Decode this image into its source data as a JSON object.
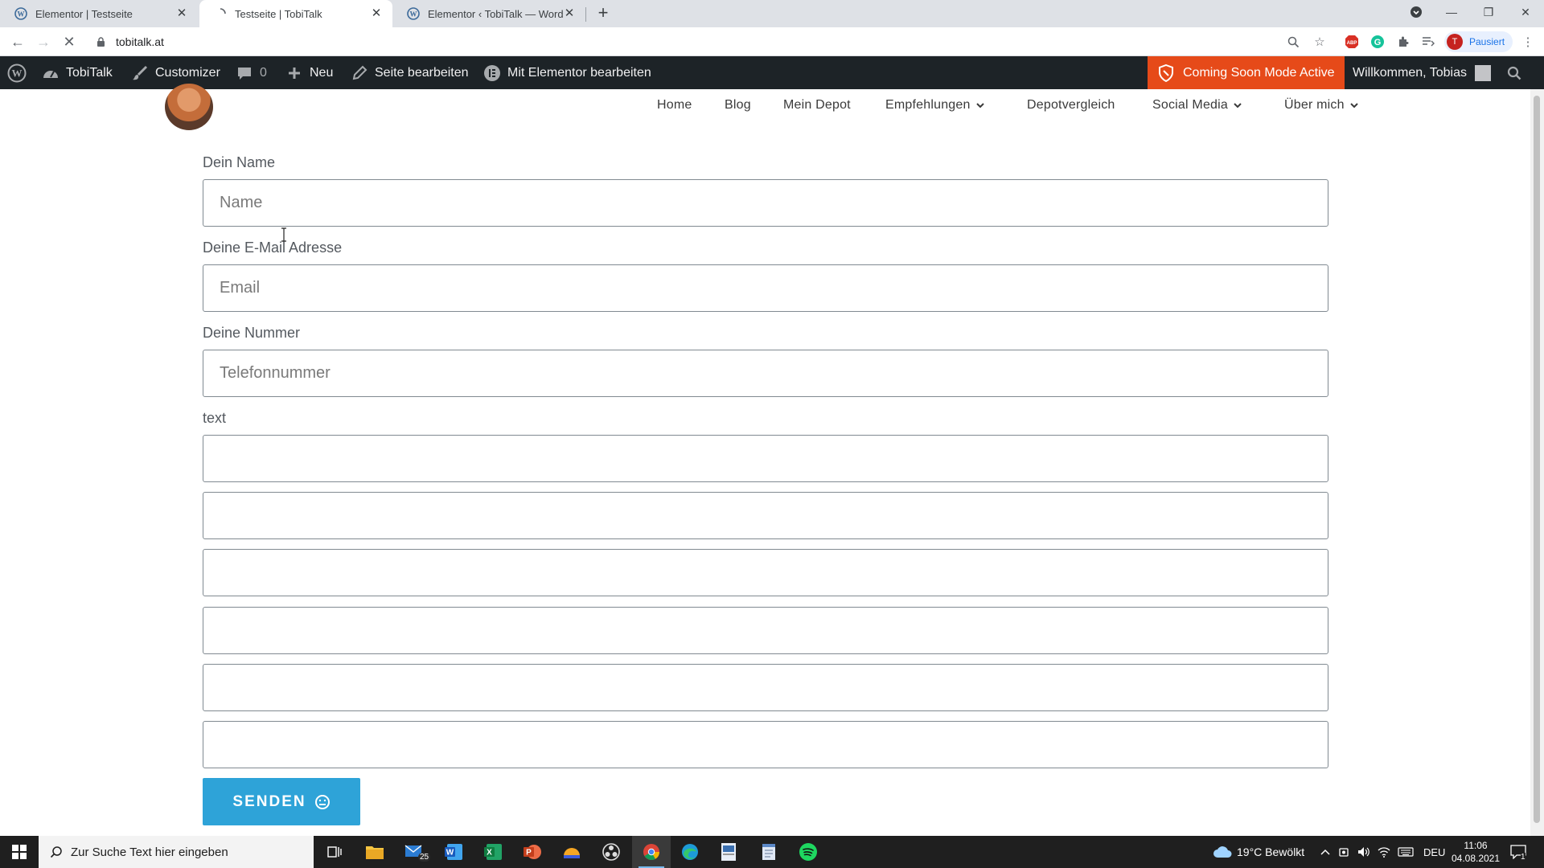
{
  "browser": {
    "tabs": [
      {
        "label": "Elementor | Testseite",
        "icon": "wordpress-icon"
      },
      {
        "label": "Testseite | TobiTalk",
        "icon": "loading-icon"
      },
      {
        "label": "Elementor ‹ TobiTalk — WordPre",
        "icon": "wordpress-icon"
      }
    ],
    "url": "tobitalk.at",
    "profile_initial": "T",
    "profile_status": "Pausiert"
  },
  "adminbar": {
    "site": "TobiTalk",
    "customizer": "Customizer",
    "comments_count": "0",
    "new": "Neu",
    "edit_page": "Seite bearbeiten",
    "edit_elementor": "Mit Elementor bearbeiten",
    "coming_soon": "Coming Soon Mode Active",
    "welcome": "Willkommen, Tobias"
  },
  "nav": {
    "items": [
      "Home",
      "Blog",
      "Mein Depot",
      "Empfehlungen",
      "Depotvergleich",
      "Social Media",
      "Über mich"
    ]
  },
  "form": {
    "name_label": "Dein Name",
    "name_placeholder": "Name",
    "email_label": "Deine E-Mail Adresse",
    "email_placeholder": "Email",
    "phone_label": "Deine Nummer",
    "phone_placeholder": "Telefonnummer",
    "text_label": "text",
    "submit_label": "SENDEN"
  },
  "taskbar": {
    "search_placeholder": "Zur Suche Text hier eingeben",
    "mail_badge": "25",
    "weather": "19°C  Bewölkt",
    "lang": "DEU",
    "time": "11:06",
    "date": "04.08.2021",
    "notifications": "1"
  },
  "colors": {
    "adminbar": "#1d2327",
    "coming_soon": "#e64a19",
    "button": "#2ea3d8"
  }
}
